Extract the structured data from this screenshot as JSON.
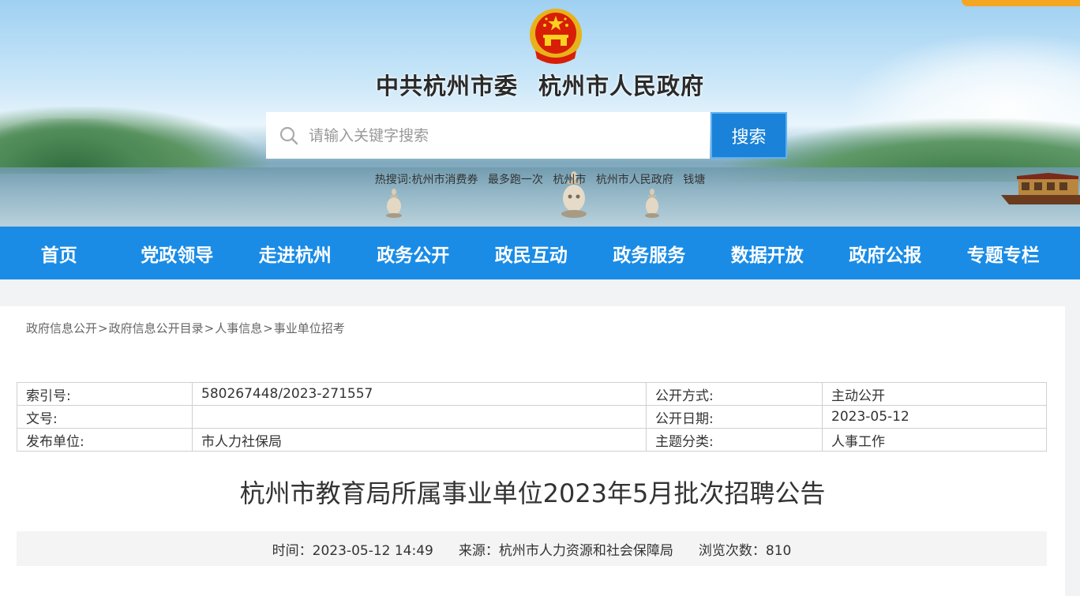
{
  "header": {
    "title_party": "中共杭州市委",
    "title_gov": "杭州市人民政府",
    "search": {
      "placeholder": "请输入关键字搜索",
      "button_label": "搜索"
    },
    "hot_words": {
      "label": "热搜词:",
      "items": [
        "杭州市消费券",
        "最多跑一次",
        "杭州市",
        "杭州市人民政府",
        "钱塘"
      ]
    }
  },
  "nav": {
    "items": [
      "首页",
      "党政领导",
      "走进杭州",
      "政务公开",
      "政民互动",
      "政务服务",
      "数据开放",
      "政府公报",
      "专题专栏"
    ]
  },
  "breadcrumb": [
    "政府信息公开",
    "政府信息公开目录",
    "人事信息",
    "事业单位招考"
  ],
  "meta": {
    "rows": [
      {
        "k1": "索引号:",
        "v1": "580267448/2023-271557",
        "k2": "公开方式:",
        "v2": "主动公开"
      },
      {
        "k1": "文号:",
        "v1": "",
        "k2": "公开日期:",
        "v2": "2023-05-12"
      },
      {
        "k1": "发布单位:",
        "v1": "市人力社保局",
        "k2": "主题分类:",
        "v2": "人事工作"
      }
    ]
  },
  "article": {
    "title": "杭州市教育局所属事业单位2023年5月批次招聘公告",
    "time": "时间：2023-05-12 14:49",
    "source": "来源：杭州市人力资源和社会保障局",
    "views": "浏览次数：810"
  },
  "colors": {
    "nav_bg": "#1a8ce6",
    "search_button": "#1a82d8",
    "accent_orange": "#f5a623"
  }
}
